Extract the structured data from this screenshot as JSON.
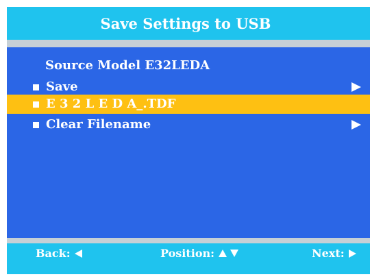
{
  "title": "Save Settings to USB",
  "source_model": "Source Model E32LEDA",
  "menu": {
    "items": [
      {
        "label": "Save",
        "has_arrow": true,
        "selected": false
      },
      {
        "label": "E 3 2 L E D A_.TDF",
        "has_arrow": false,
        "selected": true
      },
      {
        "label": "Clear Filename",
        "has_arrow": true,
        "selected": false
      }
    ]
  },
  "footer": {
    "back_label": "Back:",
    "position_label": "Position:",
    "next_label": "Next:"
  },
  "icons": {
    "bullet": "square-bullet-icon",
    "submenu": "triangle-right-icon",
    "back": "triangle-left-icon",
    "up": "triangle-up-icon",
    "down": "triangle-down-icon",
    "next": "triangle-right-icon"
  },
  "colors": {
    "header_footer_bg": "#1fc3ee",
    "panel_bg": "#2b66e6",
    "selected_bg": "#fec012",
    "separator": "#c6d0d6",
    "text": "#ffffff"
  }
}
